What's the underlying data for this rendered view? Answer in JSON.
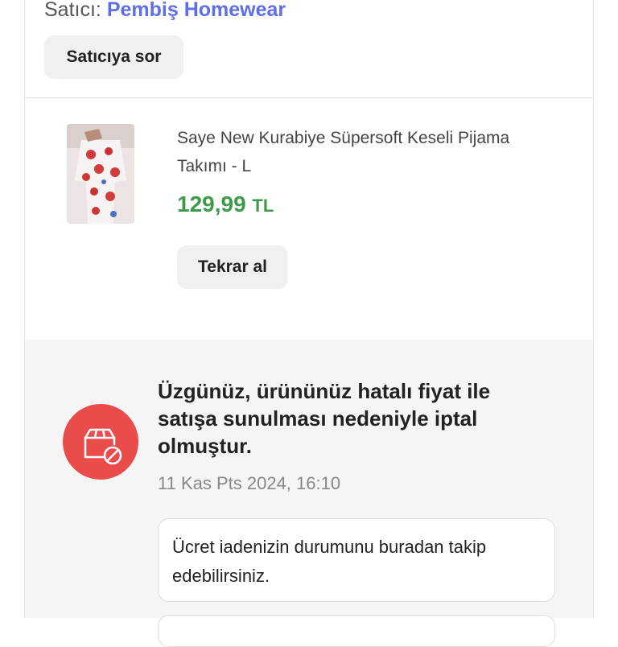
{
  "seller": {
    "label": "Satıcı:",
    "name": "Pembiş Homewear",
    "ask_button": "Satıcıya sor"
  },
  "product": {
    "name": "Saye New Kurabiye Süpersoft Keseli Pijama Takımı - L",
    "price": "129,99",
    "currency": "TL",
    "rebuy_button": "Tekrar al"
  },
  "cancellation": {
    "icon": "cancelled-box-icon",
    "title": "Üzgünüz, ürününüz hatalı fiyat ile satışa sunulması nedeniyle iptal olmuştur.",
    "date": "11 Kas Pts 2024, 16:10",
    "refund_message": "Ücret iadenizin durumunu buradan takip edebilirsiniz."
  },
  "colors": {
    "seller_link": "#5d6ee8",
    "price": "#3e9a4a",
    "cancel_icon_bg": "#ea4b4b",
    "notice_bg": "#f5f5f5"
  }
}
